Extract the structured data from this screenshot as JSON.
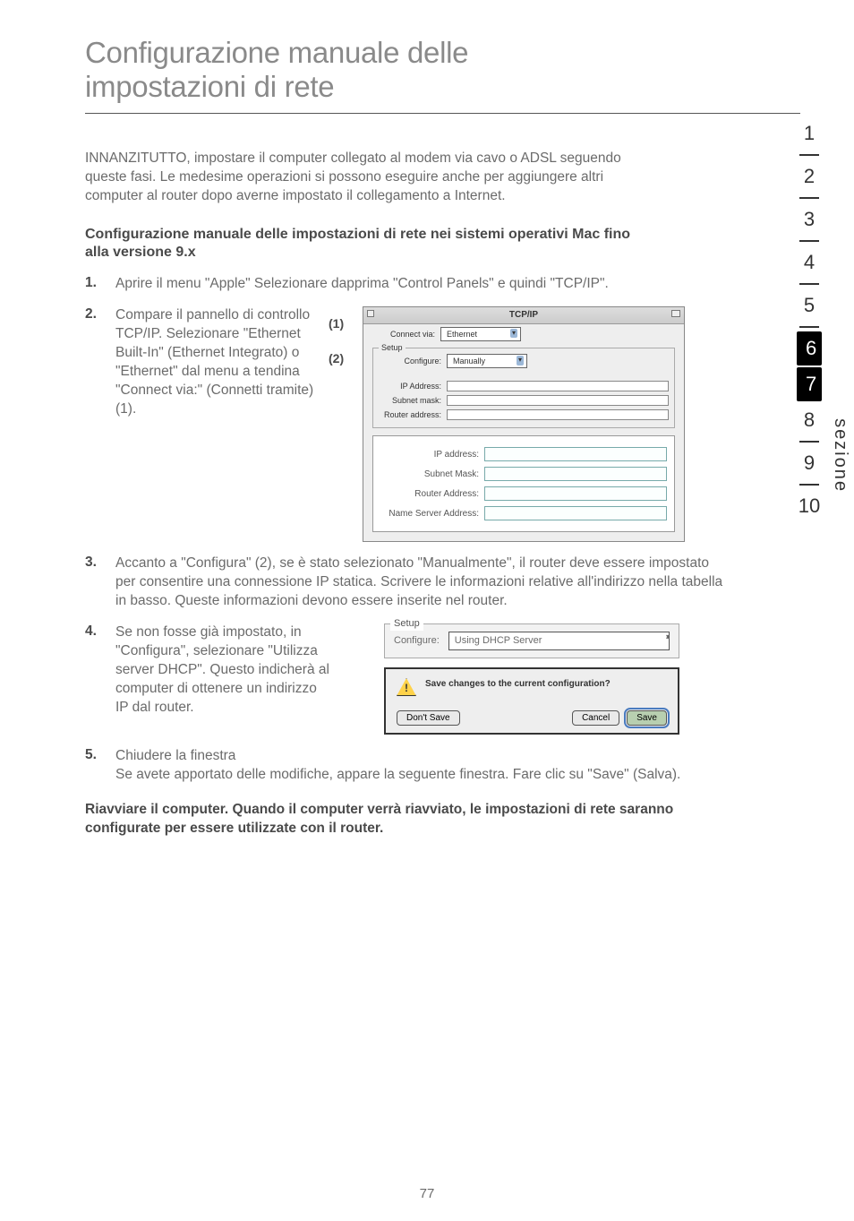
{
  "title_line1": "Configurazione manuale delle",
  "title_line2": "impostazioni di rete",
  "intro": "INNANZITUTTO, impostare il computer collegato al modem via cavo o ADSL seguendo queste fasi. Le medesime operazioni si possono eseguire anche per aggiungere altri computer al router dopo averne impostato il collegamento a Internet.",
  "sub_head": "Configurazione manuale delle impostazioni di rete nei sistemi operativi Mac fino alla versione 9.x",
  "steps": {
    "s1": "Aprire il menu \"Apple\" Selezionare dapprima \"Control Panels\" e quindi \"TCP/IP\".",
    "s2": "Compare il pannello di controllo TCP/IP. Selezionare \"Ethernet Built-In\" (Ethernet Integrato) o \"Ethernet\" dal menu a tendina \"Connect via:\" (Connetti tramite) (1).",
    "s3": "Accanto a \"Configura\" (2), se è stato selezionato \"Manualmente\", il router deve essere impostato per consentire una connessione IP statica. Scrivere le informazioni relative all'indirizzo nella tabella in basso. Queste informazioni devono essere inserite nel router.",
    "s4": "Se non fosse già impostato, in \"Configura\", selezionare \"Utilizza server DHCP\". Questo indicherà al computer di ottenere un indirizzo IP dal router.",
    "s5_a": "Chiudere la finestra",
    "s5_b": "Se avete apportato delle modifiche, appare la seguente finestra. Fare clic su \"Save\" (Salva)."
  },
  "nums": {
    "n1": "1.",
    "n2": "2.",
    "n3": "3.",
    "n4": "4.",
    "n5": "5."
  },
  "callouts": {
    "c1": "(1)",
    "c2": "(2)"
  },
  "tcpip": {
    "title": "TCP/IP",
    "connect_via_label": "Connect via:",
    "connect_via_value": "Ethernet",
    "setup_legend": "Setup",
    "configure_label": "Configure:",
    "configure_value": "Manually",
    "ip_label": "IP Address:",
    "subnet_label": "Subnet mask:",
    "router_label": "Router address:",
    "inner_ip": "IP address:",
    "inner_subnet": "Subnet Mask:",
    "inner_router": "Router Address:",
    "inner_ns": "Name Server Address:"
  },
  "setup": {
    "legend": "Setup",
    "configure_label": "Configure:",
    "dhcp_value": "Using DHCP Server"
  },
  "dialog": {
    "msg": "Save changes to the current configuration?",
    "dont_save": "Don't Save",
    "cancel": "Cancel",
    "save": "Save"
  },
  "final": "Riavviare il computer. Quando il computer verrà riavviato, le impostazioni di rete saranno configurate per essere utilizzate con il router.",
  "page_num": "77",
  "rail": [
    "1",
    "2",
    "3",
    "4",
    "5",
    "6",
    "7",
    "8",
    "9",
    "10"
  ],
  "rail_active_a": "6",
  "rail_active_b": "7",
  "sezione": "sezione"
}
